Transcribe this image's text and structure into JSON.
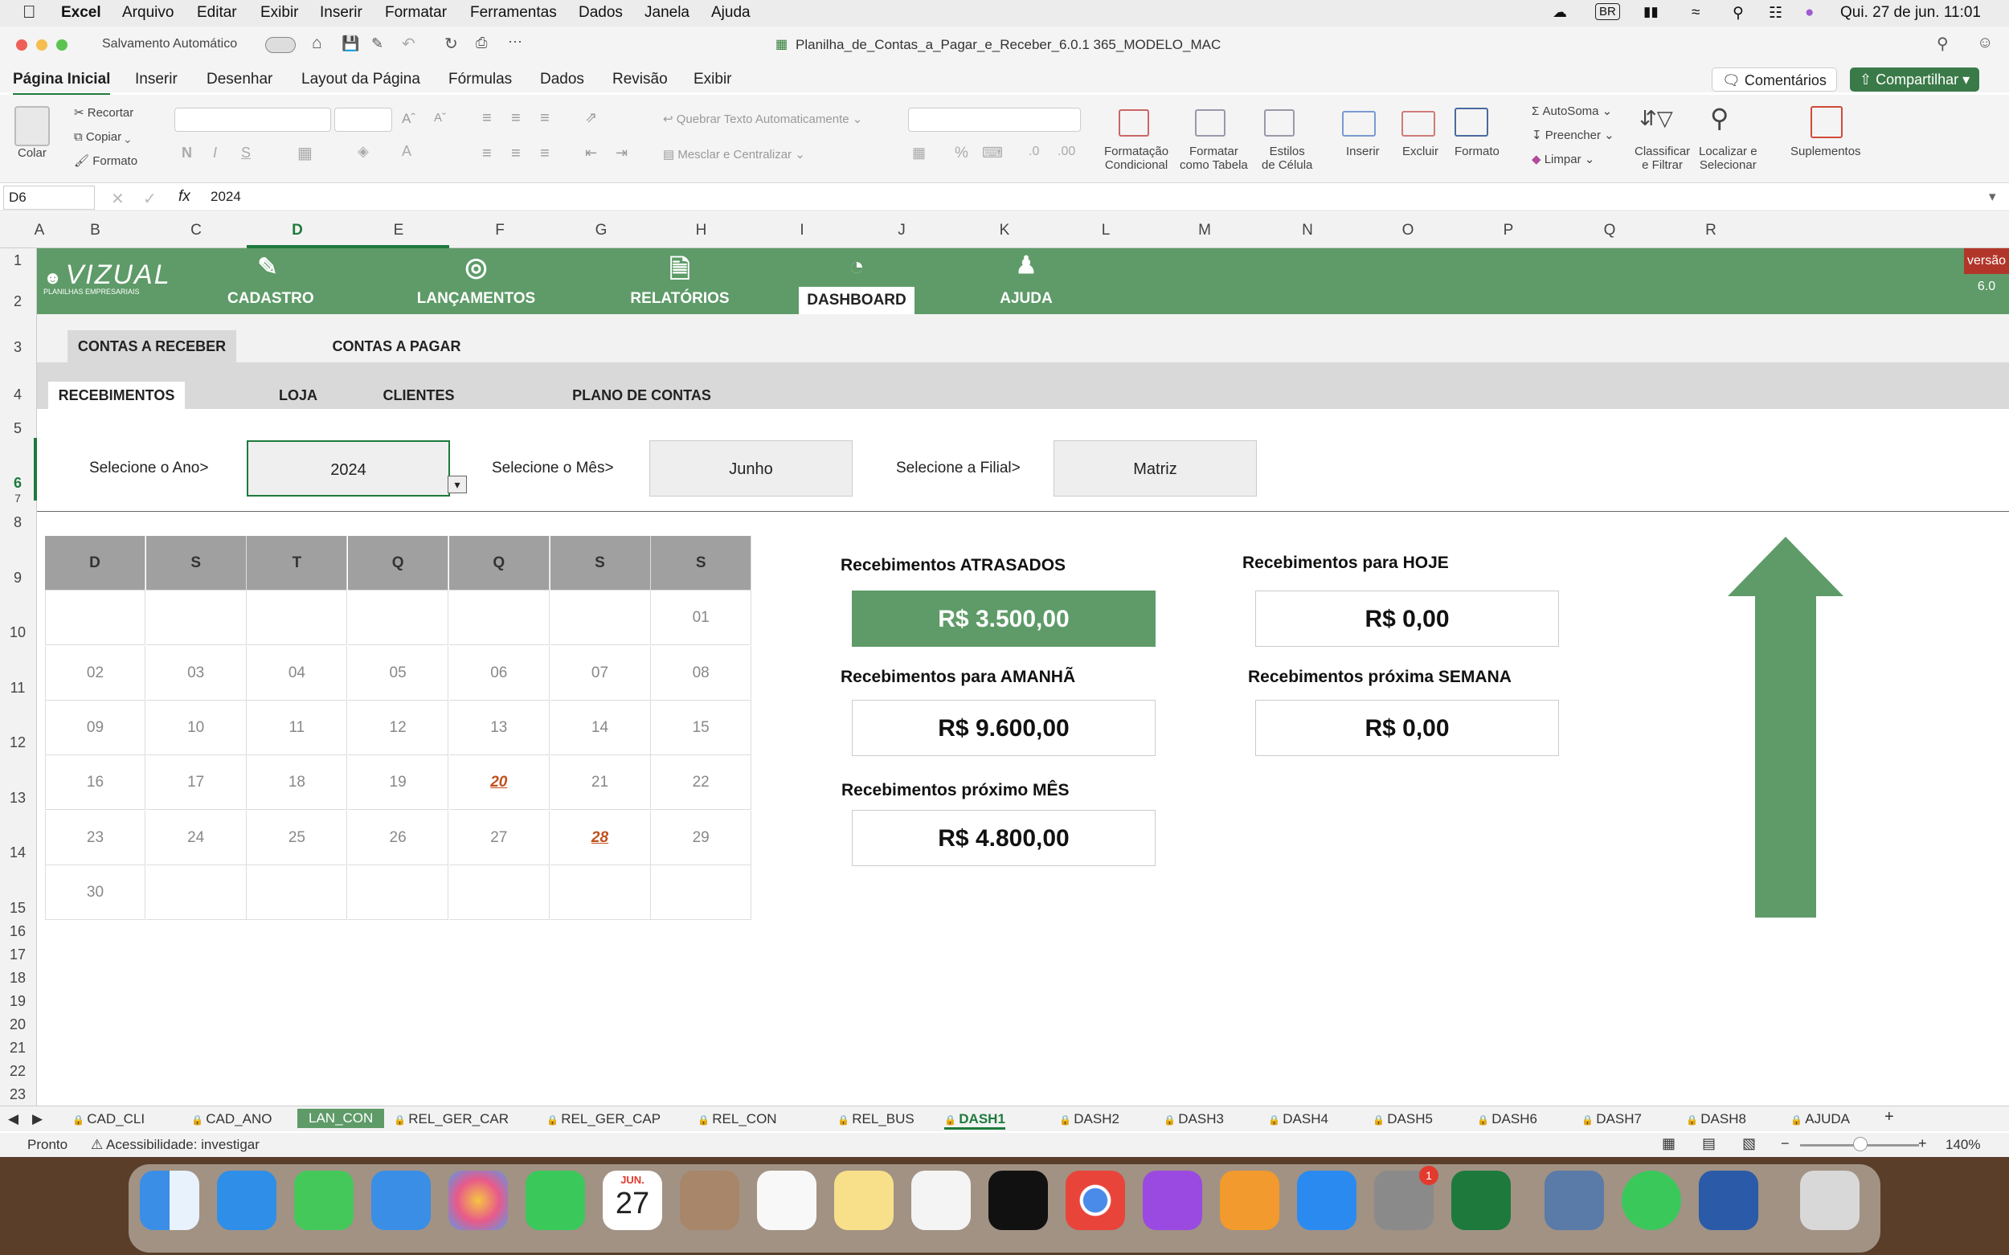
{
  "menubar": {
    "app": "Excel",
    "items": [
      "Arquivo",
      "Editar",
      "Exibir",
      "Inserir",
      "Formatar",
      "Ferramentas",
      "Dados",
      "Janela",
      "Ajuda"
    ],
    "input_badge": "BR",
    "clock": "Qui. 27 de jun.  11:01"
  },
  "titlebar": {
    "autosave": "Salvamento Automático",
    "filename": "Planilha_de_Contas_a_Pagar_e_Receber_6.0.1 365_MODELO_MAC",
    "comments": "Comentários",
    "share": "Compartilhar"
  },
  "ribbon_tabs": [
    "Página Inicial",
    "Inserir",
    "Desenhar",
    "Layout da Página",
    "Fórmulas",
    "Dados",
    "Revisão",
    "Exibir"
  ],
  "ribbon": {
    "paste": "Colar",
    "cut": "Recortar",
    "copy": "Copiar",
    "format_painter": "Formato",
    "wrap": "Quebrar Texto Automaticamente",
    "merge": "Mesclar e Centralizar",
    "cond_fmt": "Formatação\nCondicional",
    "fmt_table": "Formatar\ncomo Tabela",
    "cell_styles": "Estilos\nde Célula",
    "insert": "Inserir",
    "delete": "Excluir",
    "format": "Formato",
    "autosum": "AutoSoma",
    "fill": "Preencher",
    "clear": "Limpar",
    "sort": "Classificar\ne Filtrar",
    "find": "Localizar e\nSelecionar",
    "addins": "Suplementos"
  },
  "formula_bar": {
    "cell_ref": "D6",
    "fx": "fx",
    "value": "2024"
  },
  "columns": [
    "A",
    "B",
    "C",
    "D",
    "E",
    "F",
    "G",
    "H",
    "I",
    "J",
    "K",
    "L",
    "M",
    "N",
    "O",
    "P",
    "Q",
    "R"
  ],
  "rows": [
    "1",
    "2",
    "3",
    "4",
    "5",
    "6",
    "7",
    "8",
    "9",
    "10",
    "11",
    "12",
    "13",
    "14",
    "15",
    "16",
    "17",
    "18",
    "19",
    "20",
    "21",
    "22",
    "23"
  ],
  "nav": {
    "logo": "VIZUAL",
    "logo_sub": "PLANILHAS EMPRESARIAIS",
    "items": [
      "CADASTRO",
      "LANÇAMENTOS",
      "RELATÓRIOS",
      "DASHBOARD",
      "AJUDA"
    ],
    "version": "versão 6.0"
  },
  "tabs1": [
    "CONTAS A RECEBER",
    "CONTAS A PAGAR"
  ],
  "tabs2": [
    "RECEBIMENTOS",
    "LOJA",
    "CLIENTES",
    "PLANO DE CONTAS"
  ],
  "filters": {
    "year_label": "Selecione o Ano>",
    "year": "2024",
    "month_label": "Selecione o Mês>",
    "month": "Junho",
    "branch_label": "Selecione a Filial>",
    "branch": "Matriz"
  },
  "calendar": {
    "weekdays": [
      "D",
      "S",
      "T",
      "Q",
      "Q",
      "S",
      "S"
    ],
    "weeks": [
      [
        "",
        "",
        "",
        "",
        "",
        "",
        "01"
      ],
      [
        "02",
        "03",
        "04",
        "05",
        "06",
        "07",
        "08"
      ],
      [
        "09",
        "10",
        "11",
        "12",
        "13",
        "14",
        "15"
      ],
      [
        "16",
        "17",
        "18",
        "19",
        "20",
        "21",
        "22"
      ],
      [
        "23",
        "24",
        "25",
        "26",
        "27",
        "28",
        "29"
      ],
      [
        "30",
        "",
        "",
        "",
        "",
        "",
        ""
      ]
    ],
    "highlighted": [
      "20",
      "28"
    ]
  },
  "kpis": {
    "atrasados_label": "Recebimentos ATRASADOS",
    "atrasados": "R$ 3.500,00",
    "hoje_label": "Recebimentos para HOJE",
    "hoje": "R$ 0,00",
    "amanha_label": "Recebimentos para AMANHÃ",
    "amanha": "R$ 9.600,00",
    "semana_label": "Recebimentos próxima SEMANA",
    "semana": "R$ 0,00",
    "mes_label": "Recebimentos próximo MÊS",
    "mes": "R$ 4.800,00"
  },
  "sheets": [
    "CAD_CLI",
    "CAD_ANO",
    "LAN_CON",
    "REL_GER_CAR",
    "REL_GER_CAP",
    "REL_CON",
    "REL_BUS",
    "DASH1",
    "DASH2",
    "DASH3",
    "DASH4",
    "DASH5",
    "DASH6",
    "DASH7",
    "DASH8",
    "AJUDA"
  ],
  "status": {
    "ready": "Pronto",
    "accessibility": "Acessibilidade: investigar",
    "zoom": "140%"
  },
  "dock": {
    "calendar_month": "JUN.",
    "calendar_day": "27",
    "badge": "1"
  },
  "colors": {
    "green": "#5e9b68",
    "red_badge": "#b2352a",
    "highlight_day": "#c0501d"
  }
}
